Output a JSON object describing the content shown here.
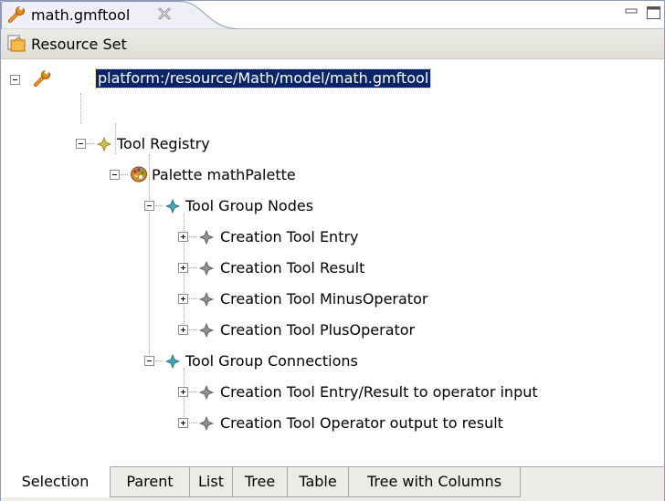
{
  "editor_tab": {
    "title": "math.gmftool",
    "icon": "wrench-icon"
  },
  "header": {
    "label": "Resource Set",
    "icon": "resource-set-icon"
  },
  "tree": {
    "root": "platform:/resource/Math/model/math.gmftool",
    "registry": "Tool Registry",
    "palette": "Palette mathPalette",
    "group_nodes": "Tool Group Nodes",
    "node_items": [
      "Creation Tool Entry",
      "Creation Tool Result",
      "Creation Tool MinusOperator",
      "Creation Tool PlusOperator"
    ],
    "group_connections": "Tool Group Connections",
    "connection_items": [
      "Creation Tool Entry/Result to operator input",
      "Creation Tool Operator output to result"
    ]
  },
  "bottom_tabs": [
    "Selection",
    "Parent",
    "List",
    "Tree",
    "Table",
    "Tree with Columns"
  ],
  "active_bottom_tab": "Selection",
  "colors": {
    "selection": "#0a246a",
    "tab_bg": "#ecebe6",
    "border": "#8d9bb8"
  }
}
